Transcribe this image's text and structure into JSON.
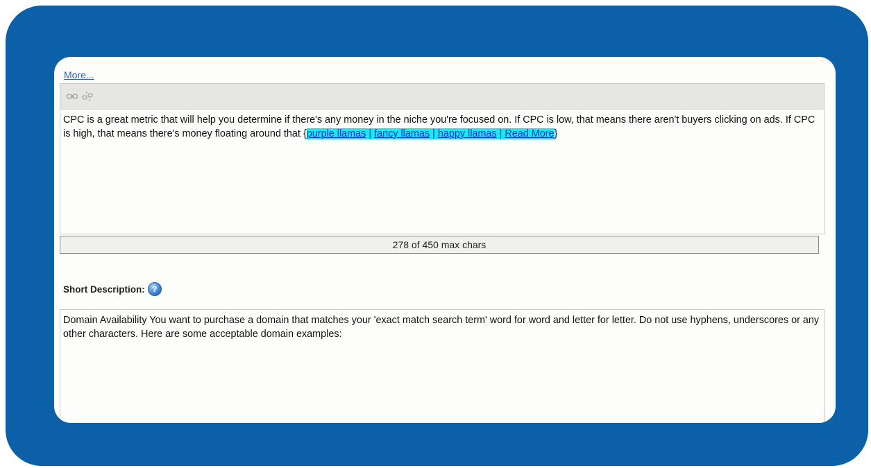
{
  "more_link": "More...",
  "editor": {
    "toolbar": {
      "link_icon": "link-icon",
      "unlink_icon": "unlink-icon"
    },
    "text_plain": "CPC is a great metric that will help you determine if there's any money in the niche you're focused on. If CPC is low, that means there aren't buyers clicking on ads. If CPC is high, that means there's money floating around that ",
    "brace_open": "{",
    "brace_close": "}",
    "separator": " | ",
    "links": [
      "purple llamas",
      "fancy llamas",
      "happy llamas",
      "Read More"
    ]
  },
  "counter": "278 of 450 max chars",
  "short_description": {
    "label": "Short Description:",
    "help_icon": "question-icon",
    "value": "Domain Availability You want to purchase a domain that matches your 'exact match search term' word for word and letter for letter. Do not use hyphens, underscores or any other characters. Here are some acceptable domain examples:"
  },
  "colors": {
    "frame": "#0b60a8",
    "highlight": "#19e8f2",
    "link": "#1f2fd0"
  }
}
